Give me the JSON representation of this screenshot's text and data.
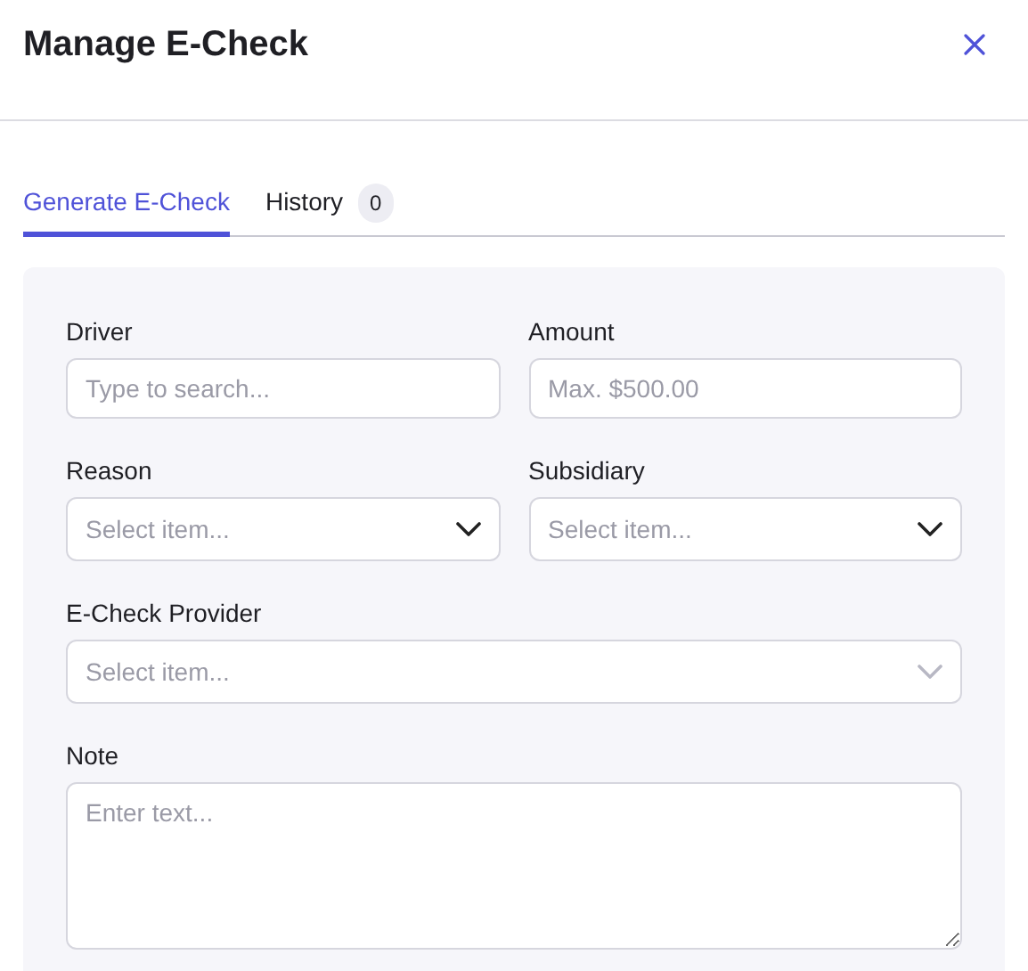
{
  "title": "Manage E-Check",
  "tabs": [
    {
      "label": "Generate E-Check",
      "selected": true
    },
    {
      "label": "History",
      "selected": false,
      "count": "0"
    }
  ],
  "rows": [
    [
      {
        "kind": "text",
        "label": "Driver",
        "placeholder": "Type to search..."
      },
      {
        "kind": "text",
        "label": "Amount",
        "placeholder": "Max. $500.00"
      }
    ],
    [
      {
        "kind": "select",
        "label": "Reason",
        "placeholder": "Select item...",
        "disabled": false
      },
      {
        "kind": "select",
        "label": "Subsidiary",
        "placeholder": "Select item...",
        "disabled": false
      }
    ],
    [
      {
        "kind": "select",
        "label": "E-Check Provider",
        "placeholder": "Select item...",
        "disabled": true
      }
    ],
    [
      {
        "kind": "textarea",
        "label": "Note",
        "placeholder": "Enter text..."
      }
    ]
  ]
}
